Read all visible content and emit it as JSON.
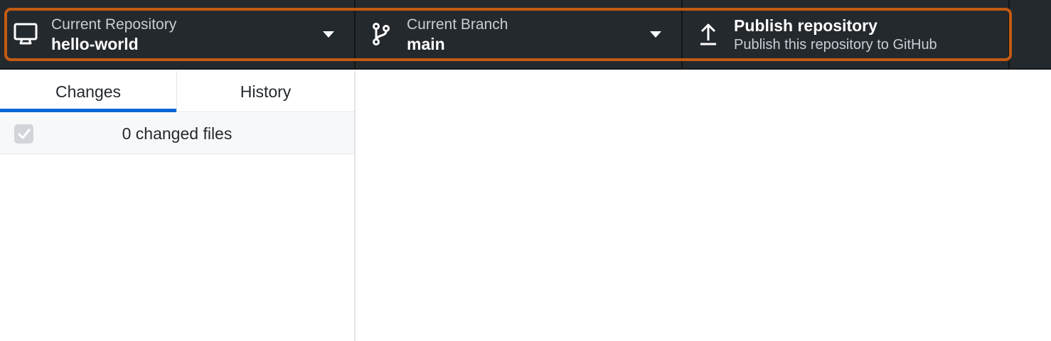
{
  "toolbar": {
    "repository": {
      "label": "Current Repository",
      "value": "hello-world",
      "icon": "desktop-icon"
    },
    "branch": {
      "label": "Current Branch",
      "value": "main",
      "icon": "git-branch-icon"
    },
    "publish": {
      "title": "Publish repository",
      "subtitle": "Publish this repository to GitHub",
      "icon": "upload-icon"
    }
  },
  "highlight_color": "#c35a11",
  "tabs": [
    {
      "label": "Changes",
      "active": true
    },
    {
      "label": "History",
      "active": false
    }
  ],
  "changes": {
    "summary": "0 changed files",
    "select_all_checked": true
  },
  "colors": {
    "toolbar_bg": "#24292e",
    "accent": "#0366d6"
  }
}
